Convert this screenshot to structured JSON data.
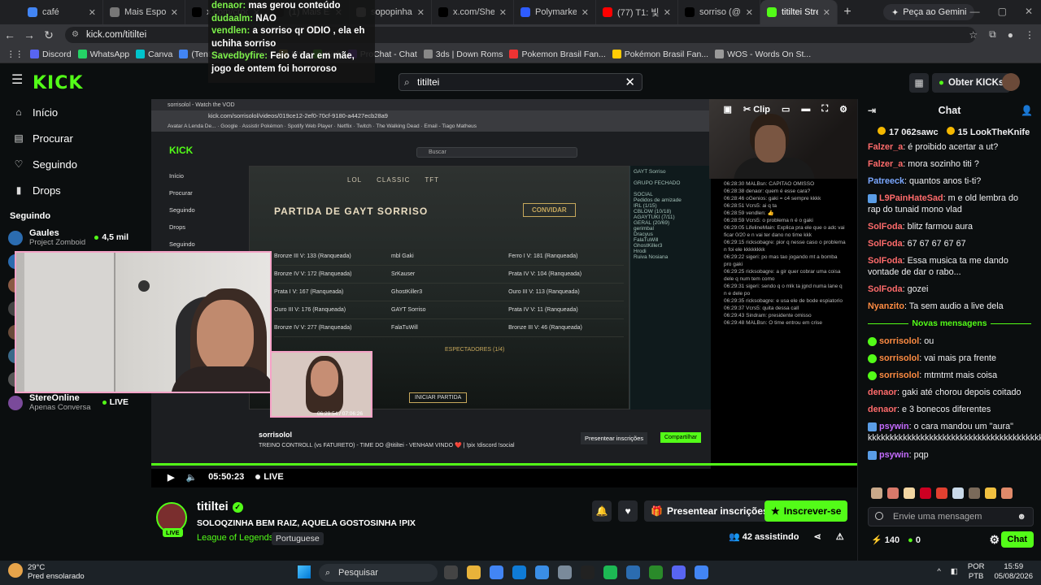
{
  "browser": {
    "tabs": [
      {
        "title": "café",
        "color": "#4285f4"
      },
      {
        "title": "Mais Esports n",
        "color": "#777"
      },
      {
        "title": "x.com/crocio",
        "color": "#000"
      },
      {
        "title": "(1) Mais Espo",
        "color": "#000"
      },
      {
        "title": "sopopinha no",
        "color": "#888"
      },
      {
        "title": "x.com/SheepE",
        "color": "#000"
      },
      {
        "title": "Polymarket Le",
        "color": "#2e5cff"
      },
      {
        "title": "(77) T1: 빛날가",
        "color": "#ff0000"
      },
      {
        "title": "sorriso (@ttoe",
        "color": "#000"
      },
      {
        "title": "titiltei Stream",
        "color": "#53fc18"
      }
    ],
    "gemini_label": "Peça ao Gemini",
    "url": "kick.com/titiltei",
    "bookmarks": [
      "Discord",
      "WhatsApp",
      "Canva",
      "(Tentando aprender...",
      "MSI",
      "Kick",
      "ProChat - Chat",
      "3ds | Down Roms",
      "Pokemon Brasil Fan...",
      "Pokémon Brasil Fan...",
      "WOS - Words On St..."
    ]
  },
  "overlay_chat": [
    {
      "user": "denaor",
      "text": "mas gerou conteúdo"
    },
    {
      "user": "dudaalm",
      "text": "NAO"
    },
    {
      "user": "vendlen",
      "text": "a sorriso qr ODIO , ela eh uchiha sorriso"
    },
    {
      "user": "Savedbyfire",
      "text": "Feio é dar em mãe, jogo de ontem foi horroroso"
    }
  ],
  "header": {
    "logo": "KICK",
    "search_value": "titiltei",
    "obter_label": "Obter KICKs"
  },
  "sidebar": {
    "nav": [
      {
        "label": "Início",
        "icon": "⌂"
      },
      {
        "label": "Procurar",
        "icon": "▤"
      },
      {
        "label": "Seguindo",
        "icon": "♡"
      },
      {
        "label": "Drops",
        "icon": "▮"
      }
    ],
    "following_title": "Seguindo",
    "following": [
      {
        "name": "Gaules",
        "game": "Project Zomboid",
        "viewers": "4,5 mil",
        "color": "#2b6cb0"
      },
      {
        "name": "Gaules",
        "game": "Project Zomboid",
        "viewers": "4,6 mil",
        "color": "#2b6cb0"
      },
      {
        "name": "Minerva",
        "game": "VALORANT",
        "viewers": "677",
        "color": "#8a5a44"
      },
      {
        "name": "lordsemi",
        "game": "League of Legends",
        "viewers": "227",
        "color": "#444"
      },
      {
        "name": "AxT",
        "game": "Misfall Hunter",
        "viewers": "LIVE",
        "color": "#6a4b3a"
      },
      {
        "name": "ZingoSquad",
        "game": "Slots & Casino",
        "viewers": "LIVE",
        "color": "#3a6a8a"
      },
      {
        "name": "brkk",
        "game": "IRL",
        "viewers": "4,6 mil",
        "color": "#555"
      },
      {
        "name": "StereOnline",
        "game": "Apenas Conversa",
        "viewers": "LIVE",
        "color": "#7a4a9a"
      }
    ]
  },
  "inner_stream": {
    "url": "kick.com/sorrisolol/videos/019ce12-2ef0-70cf-9180-a4427ecb28a9",
    "search_placeholder": "Buscar",
    "game_title": "PARTIDA DE GAYT SORRISO",
    "game_tabs": [
      "LOL",
      "CLASSIC",
      "TFT"
    ],
    "convidar": "CONVIDAR",
    "team_rows": [
      [
        "Bronze III V: 133 (Ranqueada)",
        "mbl Gaki",
        "Ferro I V: 181 (Ranqueada)"
      ],
      [
        "Bronze IV V: 172 (Ranqueada)",
        "SrKauser",
        "Prata IV V: 104 (Ranqueada)"
      ],
      [
        "Prata I V: 167 (Ranqueada)",
        "GhostKiller3",
        "Ouro III V: 113 (Ranqueada)"
      ],
      [
        "Ouro III V: 176 (Ranqueada)",
        "GAYT Sorriso",
        "Prata IV V: 11 (Ranqueada)"
      ],
      [
        "Bronze IV V: 277 (Ranqueada)",
        "FalaTuWill",
        "Bronze III V: 46 (Ranqueada)"
      ]
    ],
    "inner_chat": [
      "06:28:30 MALBsn: CAPITAO OMISSO",
      "06:28:38 denaor: quem é esse cara?",
      "06:28:46 oGenios: gaki = c4 sempre kkkk",
      "06:28:51 Vcrs5: ai q ta",
      "06:28:59 vendlen: 👍",
      "06:28:59 Vcrs5: o problema n é o gaki",
      "06:29:05 LifelineMain: Explica pra ele que o adc vai ficar 0/20 e n vai ter dano no time kkk",
      "06:29:15 ricksobagre: pior q nesse caso o problema n foi ele kkkkkkkk",
      "06:29:22 sigeri: po mas tao jogando mt a bomba pro gaki",
      "06:29:25 ricksobagre: a gir quer cobrar uma coisa dele q num tem como",
      "06:29:31 sigeri: sendo q o mlk ta jgnd numa lane q n e dele po",
      "06:29:35 ricksobagre: e usa ele de bode espiatorio",
      "06:29:37 Vcrs5: quita dessa call",
      "06:29:43 Sindram: presidente omisso",
      "06:29:48 MALBsn: O time entrou em crise"
    ],
    "streamer": "sorrisolol",
    "stream_title": "TREINO CONTROLL (vs FATURETO) - TIME DO @titiltei - VENHAM VINDO ❤️ | !pix !discord !social",
    "time_inner": "06:29:54 / 07:06:26",
    "iniciar": "INICIAR PARTIDA",
    "espectadores": "ESPECTADORES (1/4)",
    "present": "Presentear inscrições",
    "share": "Compartilhar"
  },
  "player": {
    "time": "05:50:23",
    "live_label": "LIVE",
    "clip_label": "Clip"
  },
  "channel": {
    "name": "titiltei",
    "title": "SOLOQZINHA BEM RAIZ, AQUELA GOSTOSINHA !PIX",
    "category": "League of Legends",
    "language": "Portuguese",
    "live": "LIVE",
    "present_label": "Presentear inscrições",
    "subscribe_label": "Inscrever-se",
    "watching": "42 assistindo"
  },
  "chat": {
    "title": "Chat",
    "pinned": [
      {
        "name": "062sawc",
        "count": "17"
      },
      {
        "name": "LookTheKnife",
        "count": "15"
      }
    ],
    "messages": [
      {
        "user": "Falzer_a",
        "color": "#ff6b6b",
        "text": "é proibido acertar a ut?",
        "type": "none"
      },
      {
        "user": "Falzer_a",
        "color": "#ff6b6b",
        "text": "mora sozinho titi ?",
        "type": "none"
      },
      {
        "user": "Patreeck",
        "color": "#7aa7ff",
        "text": "quantos anos ti-ti?",
        "type": "none"
      },
      {
        "user": "L9PainHateSad",
        "color": "#ff6b6b",
        "text": "m e old lembra do rap do tunaid mono vlad",
        "type": "sub"
      },
      {
        "user": "SolFoda",
        "color": "#ff6b6b",
        "text": "blitz farmou aura",
        "type": "none"
      },
      {
        "user": "SolFoda",
        "color": "#ff6b6b",
        "text": "67 67 67 67 67",
        "type": "none"
      },
      {
        "user": "SolFoda",
        "color": "#ff6b6b",
        "text": "Essa musica ta me dando vontade de dar o rabo...",
        "type": "none"
      },
      {
        "user": "SolFoda",
        "color": "#ff6b6b",
        "text": "gozei",
        "type": "none"
      },
      {
        "user": "Nyanzito",
        "color": "#ff8c42",
        "text": "Ta sem audio a live dela",
        "type": "none"
      }
    ],
    "novas_label": "Novas mensagens",
    "new_messages": [
      {
        "user": "sorrisolol",
        "color": "#ff8c42",
        "text": "ou",
        "type": "mod"
      },
      {
        "user": "sorrisolol",
        "color": "#ff8c42",
        "text": "vai mais pra frente",
        "type": "mod"
      },
      {
        "user": "sorrisolol",
        "color": "#ff8c42",
        "text": "mtmtmt mais coisa",
        "type": "mod"
      },
      {
        "user": "denaor",
        "color": "#ff6b6b",
        "text": "gaki até chorou depois coitado",
        "type": "none"
      },
      {
        "user": "denaor",
        "color": "#ff6b6b",
        "text": "e 3 bonecos diferentes",
        "type": "none"
      },
      {
        "user": "psywin",
        "color": "#c56cff",
        "text": "o cara mandou um \"aura\" kkkkkkkkkkkkkkkkkkkkkkkkkkkkkkkkkkkkkkkkkkkkkkkk",
        "type": "sub"
      },
      {
        "user": "psywin",
        "color": "#c56cff",
        "text": "pqp",
        "type": "sub"
      }
    ],
    "input_placeholder": "Envie uma mensagem",
    "points": "140",
    "kicks": "0",
    "send_label": "Chat"
  },
  "taskbar": {
    "temp": "29°C",
    "weather": "Pred ensolarado",
    "search": "Pesquisar",
    "lang1": "POR",
    "lang2": "PTB",
    "time": "15:59",
    "date": "05/08/2026"
  }
}
